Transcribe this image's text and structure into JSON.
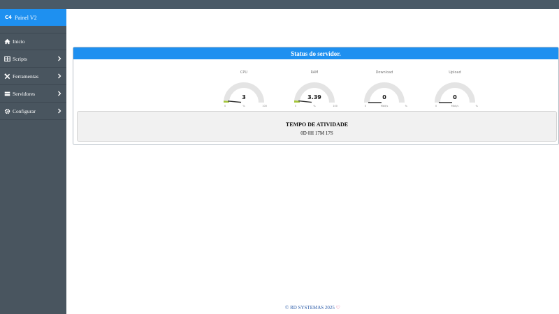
{
  "brand": {
    "icon_text": "C4",
    "title": "Painel V2"
  },
  "sidebar": {
    "items": [
      {
        "label": "Inicio",
        "icon": "home-icon"
      },
      {
        "label": "Scripts",
        "icon": "table-icon",
        "chevron": true
      },
      {
        "label": "Ferramentas",
        "icon": "tools-icon",
        "chevron": true
      },
      {
        "label": "Servidores",
        "icon": "server-icon",
        "chevron": true
      },
      {
        "label": "Configurar",
        "icon": "gear-icon",
        "chevron": true
      }
    ]
  },
  "status": {
    "title": "Status do servidor.",
    "gauges": [
      {
        "label": "CPU",
        "value": "3",
        "min": "0",
        "unit": "%",
        "max": "100",
        "fill": 0.03
      },
      {
        "label": "RAM",
        "value": "3.39",
        "min": "0",
        "unit": "%",
        "max": "100",
        "fill": 0.0339
      },
      {
        "label": "Download",
        "value": "0",
        "min": "0",
        "unit": "Mbit/s",
        "max": "%",
        "fill": 0.0
      },
      {
        "label": "Upload",
        "value": "0",
        "min": "0",
        "unit": "Mbit/s",
        "max": "%",
        "fill": 0.0
      }
    ],
    "uptime_title": "TEMPO DE ATIVIDADE",
    "uptime_value": "0D 0H 17M 17S"
  },
  "footer": {
    "text": "© RD SYSTEMAS 2025"
  },
  "colors": {
    "accent": "#1e90f0",
    "sidebar": "#49555f",
    "gauge_track": "#e4e4e4",
    "gauge_fill": "#a4c639",
    "gauge_needle": "#333333"
  }
}
